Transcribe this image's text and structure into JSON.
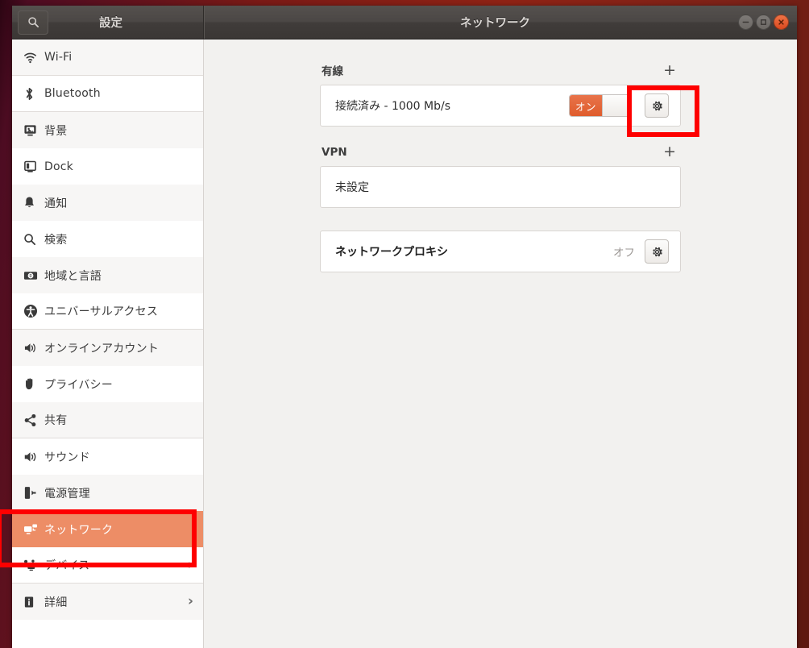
{
  "window": {
    "app_title": "設定",
    "page_title": "ネットワーク",
    "search_icon": "search-icon",
    "controls": [
      {
        "name": "minimize",
        "glyph": "−"
      },
      {
        "name": "maximize",
        "glyph": "□"
      },
      {
        "name": "close",
        "glyph": "×"
      }
    ]
  },
  "sidebar": {
    "items": [
      {
        "label": "Wi-Fi",
        "icon": "wifi-icon",
        "chevron": false,
        "selected": false
      },
      {
        "label": "Bluetooth",
        "icon": "bluetooth-icon",
        "chevron": false,
        "selected": false
      },
      {
        "label": "背景",
        "icon": "background-icon",
        "chevron": false,
        "selected": false
      },
      {
        "label": "Dock",
        "icon": "dock-icon",
        "chevron": false,
        "selected": false
      },
      {
        "label": "通知",
        "icon": "bell-icon",
        "chevron": false,
        "selected": false
      },
      {
        "label": "検索",
        "icon": "search-icon",
        "chevron": false,
        "selected": false
      },
      {
        "label": "地域と言語",
        "icon": "region-language-icon",
        "chevron": false,
        "selected": false
      },
      {
        "label": "ユニバーサルアクセス",
        "icon": "universal-access-icon",
        "chevron": false,
        "selected": false
      },
      {
        "label": "オンラインアカウント",
        "icon": "online-accounts-icon",
        "chevron": false,
        "selected": false
      },
      {
        "label": "プライバシー",
        "icon": "privacy-hand-icon",
        "chevron": false,
        "selected": false
      },
      {
        "label": "共有",
        "icon": "sharing-icon",
        "chevron": false,
        "selected": false
      },
      {
        "label": "サウンド",
        "icon": "sound-speaker-icon",
        "chevron": false,
        "selected": false
      },
      {
        "label": "電源管理",
        "icon": "power-icon",
        "chevron": false,
        "selected": false
      },
      {
        "label": "ネットワーク",
        "icon": "network-icon",
        "chevron": false,
        "selected": true
      },
      {
        "label": "デバイス",
        "icon": "devices-icon",
        "chevron": true,
        "selected": false
      },
      {
        "label": "詳細",
        "icon": "info-icon",
        "chevron": true,
        "selected": false
      }
    ],
    "chevron_glyph": "›"
  },
  "main": {
    "wired": {
      "title": "有線",
      "add_label": "+",
      "connection_label": "接続済み - 1000 Mb/s",
      "toggle_on_label": "オン",
      "toggle_state": "on",
      "settings_icon": "gear-icon"
    },
    "vpn": {
      "title": "VPN",
      "add_label": "+",
      "empty_label": "未設定"
    },
    "proxy": {
      "label": "ネットワークプロキシ",
      "status": "オフ",
      "settings_icon": "gear-icon"
    }
  },
  "annotations": {
    "gear_highlight": "wired-settings-highlight",
    "sidebar_highlight": "network-sidebar-highlight",
    "color": "#fe0000"
  }
}
